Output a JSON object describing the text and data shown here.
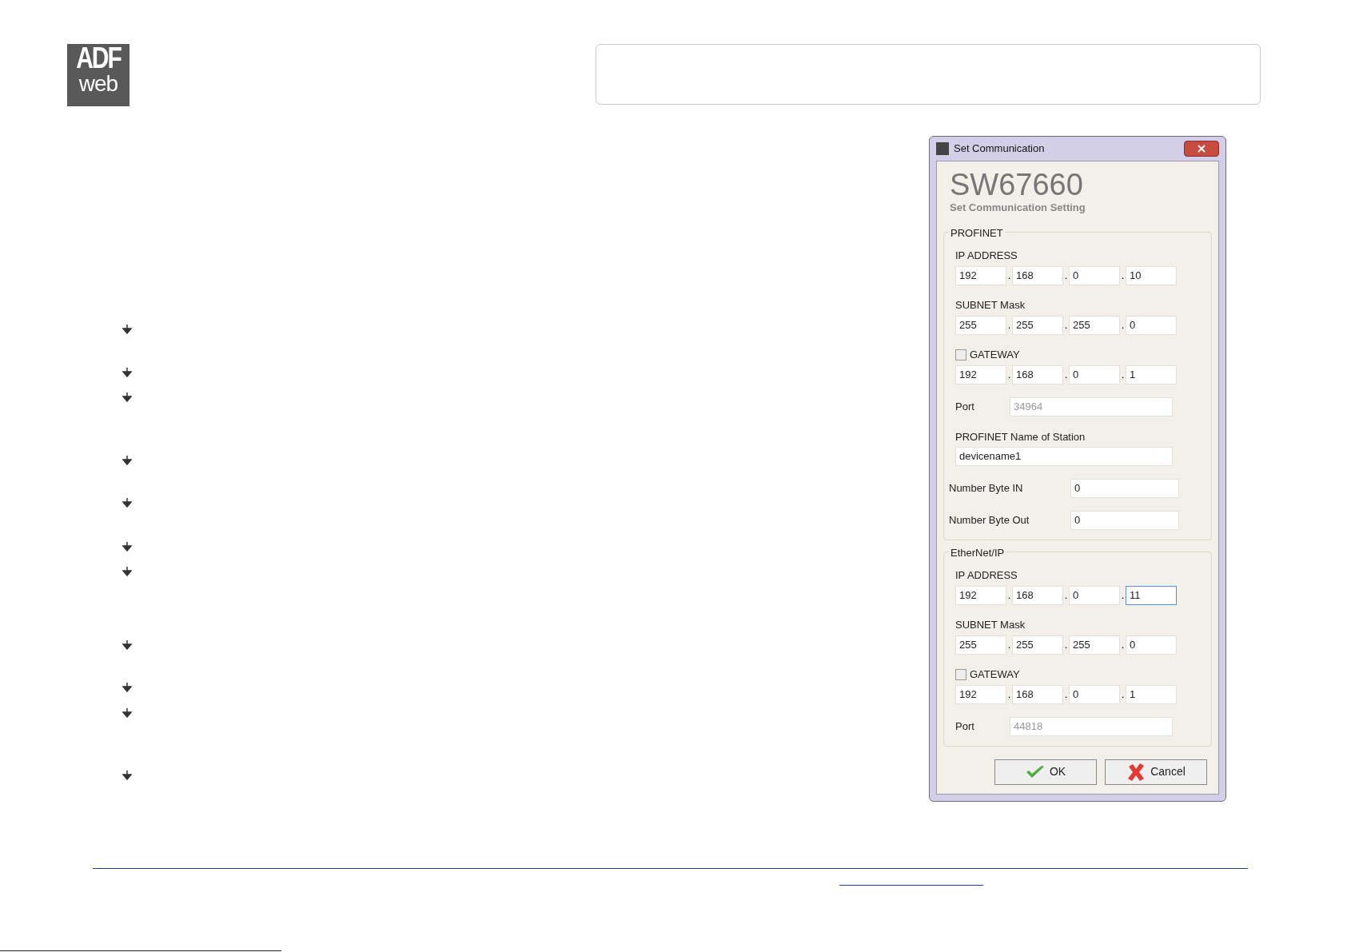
{
  "logo": {
    "top": "ADF",
    "bottom": "web"
  },
  "dialog": {
    "title": "Set Communication",
    "heading": "SW67660",
    "subheading": "Set Communication Setting",
    "groups": [
      {
        "title": "PROFINET",
        "rows": [
          {
            "kind": "ip",
            "label": "IP ADDRESS",
            "separator": ".",
            "octets": [
              {
                "value": "192",
                "focused": false
              },
              {
                "value": "168",
                "focused": false
              },
              {
                "value": "0",
                "focused": false
              },
              {
                "value": "10",
                "focused": false
              }
            ]
          },
          {
            "kind": "ip",
            "label": "SUBNET Mask",
            "separator": ".",
            "octets": [
              {
                "value": "255",
                "focused": false
              },
              {
                "value": "255",
                "focused": false
              },
              {
                "value": "255",
                "focused": false
              },
              {
                "value": "0",
                "focused": false
              }
            ]
          },
          {
            "kind": "ip",
            "label": "GATEWAY",
            "checked": false,
            "separator": ".",
            "octets": [
              {
                "value": "192",
                "focused": false
              },
              {
                "value": "168",
                "focused": false
              },
              {
                "value": "0",
                "focused": false
              },
              {
                "value": "1",
                "focused": false
              }
            ]
          },
          {
            "kind": "port",
            "label": "Port",
            "value": "34964",
            "disabled": true
          },
          {
            "kind": "text",
            "label": "PROFINET Name of Station",
            "value": "devicename1"
          },
          {
            "kind": "pair",
            "label": "Number Byte IN",
            "value": "0"
          },
          {
            "kind": "pair",
            "label": "Number Byte Out",
            "value": "0"
          }
        ]
      },
      {
        "title": "EtherNet/IP",
        "rows": [
          {
            "kind": "ip",
            "label": "IP ADDRESS",
            "separator": ".",
            "octets": [
              {
                "value": "192",
                "focused": false
              },
              {
                "value": "168",
                "focused": false
              },
              {
                "value": "0",
                "focused": false
              },
              {
                "value": "11",
                "focused": true
              }
            ]
          },
          {
            "kind": "ip",
            "label": "SUBNET Mask",
            "separator": ".",
            "octets": [
              {
                "value": "255",
                "focused": false
              },
              {
                "value": "255",
                "focused": false
              },
              {
                "value": "255",
                "focused": false
              },
              {
                "value": "0",
                "focused": false
              }
            ]
          },
          {
            "kind": "ip",
            "label": "GATEWAY",
            "checked": false,
            "separator": ".",
            "octets": [
              {
                "value": "192",
                "focused": false
              },
              {
                "value": "168",
                "focused": false
              },
              {
                "value": "0",
                "focused": false
              },
              {
                "value": "1",
                "focused": false
              }
            ]
          },
          {
            "kind": "port",
            "label": "Port",
            "value": "44818",
            "disabled": true
          }
        ]
      }
    ],
    "buttons": [
      {
        "kind": "ok",
        "label": "OK"
      },
      {
        "kind": "cancel",
        "label": "Cancel"
      }
    ]
  }
}
